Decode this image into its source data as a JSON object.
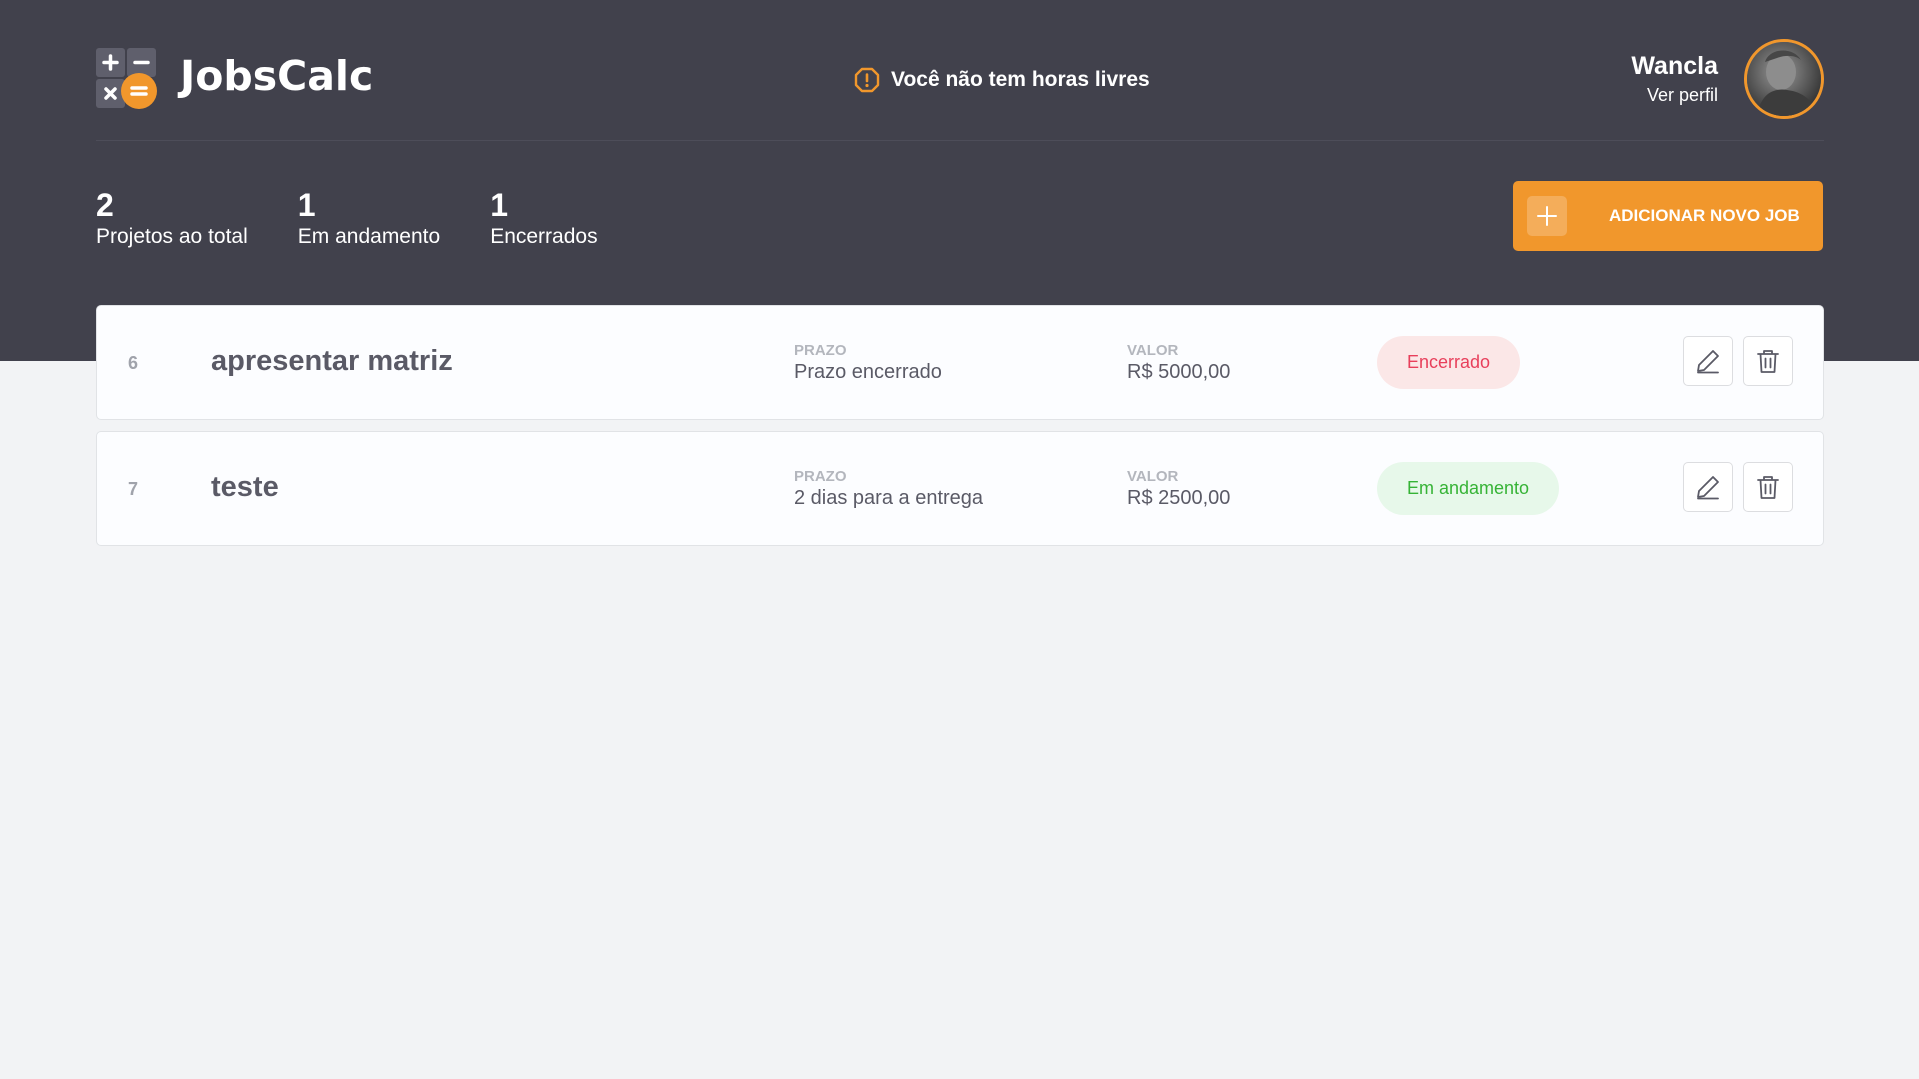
{
  "header": {
    "brand": "JobsCalc",
    "notice": "Você não tem horas livres",
    "profile": {
      "name": "Wancla",
      "link": "Ver perfil"
    }
  },
  "summary": [
    {
      "value": "2",
      "label": "Projetos ao total"
    },
    {
      "value": "1",
      "label": "Em andamento"
    },
    {
      "value": "1",
      "label": "Encerrados"
    }
  ],
  "add_button": {
    "label": "ADICIONAR NOVO JOB"
  },
  "jobs": [
    {
      "id": "6",
      "name": "apresentar matriz",
      "deadline_label": "PRAZO",
      "deadline": "Prazo encerrado",
      "value_label": "VALOR",
      "value": "R$ 5000,00",
      "status": "Encerrado"
    },
    {
      "id": "7",
      "name": "teste",
      "deadline_label": "PRAZO",
      "deadline": "2 dias para a entrega",
      "value_label": "VALOR",
      "value": "R$ 2500,00",
      "status": "Em andamento"
    }
  ],
  "colors": {
    "header_bg": "#41414c",
    "page_bg": "#f2f3f5",
    "accent": "#f1972c",
    "closed_text": "#e83f5b",
    "closed_bg": "#fbe7e7",
    "progress_text": "#36b336",
    "progress_bg": "#e7f8ea"
  },
  "icons": {
    "logo": "calculator-logo-icon",
    "notice": "alert-octagon-icon",
    "add": "plus-icon",
    "edit": "pencil-icon",
    "delete": "trash-icon"
  }
}
